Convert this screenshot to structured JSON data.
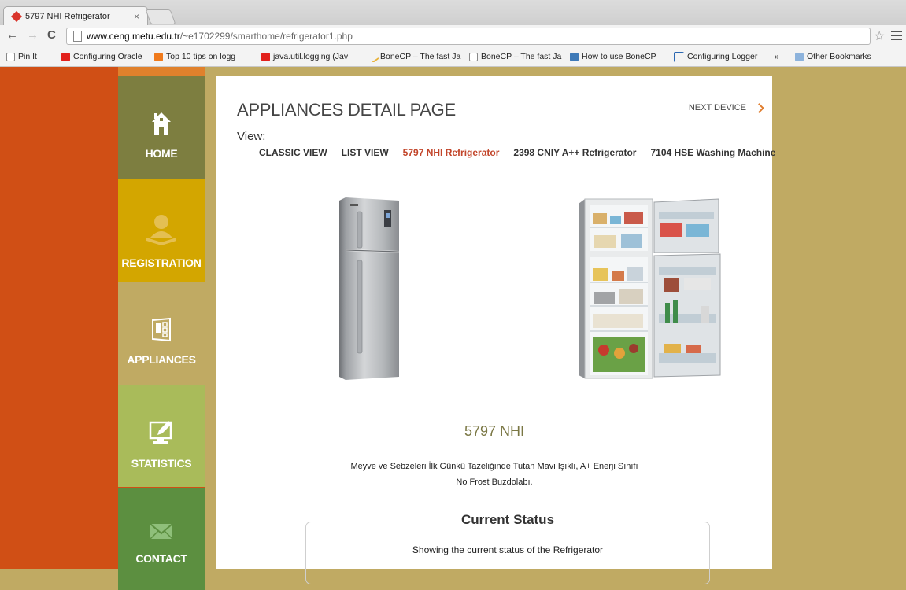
{
  "browser": {
    "tab_title": "5797 NHI Refrigerator",
    "tab_close": "×",
    "url_host": "www.ceng.metu.edu.tr",
    "url_path": "/~e1702299/smarthome/refrigerator1.php",
    "bookmarks": [
      {
        "label": "Pin It",
        "icon": "page-icon"
      },
      {
        "label": "Configuring Oracle",
        "icon": "oracle-icon"
      },
      {
        "label": "Top 10 tips on logg",
        "icon": "blogger-icon"
      },
      {
        "label": "java.util.logging (Jav",
        "icon": "oracle-icon"
      },
      {
        "label": "BoneCP – The fast Ja",
        "icon": "bone-icon"
      },
      {
        "label": "BoneCP – The fast Ja",
        "icon": "page-icon"
      },
      {
        "label": "How to use BoneCP",
        "icon": "wordpress-icon"
      },
      {
        "label": "Configuring Logger",
        "icon": "hm-icon"
      }
    ],
    "more_bookmarks": "»",
    "other_bookmarks": "Other Bookmarks"
  },
  "sidebar": {
    "items": [
      {
        "label": "HOME",
        "icon": "home-icon"
      },
      {
        "label": "REGISTRATION",
        "icon": "user-icon"
      },
      {
        "label": "APPLIANCES",
        "icon": "fridge-icon"
      },
      {
        "label": "STATISTICS",
        "icon": "monitor-pen-icon"
      },
      {
        "label": "CONTACT",
        "icon": "envelope-icon"
      }
    ]
  },
  "main": {
    "title": "APPLIANCES DETAIL PAGE",
    "next_device": "NEXT DEVICE",
    "view_label": "View:",
    "view_links": [
      "CLASSIC VIEW",
      "LIST VIEW",
      "5797 NHI Refrigerator",
      "2398 CNIY A++ Refrigerator",
      "7104 HSE Washing Machine"
    ],
    "active_view": "5797 NHI Refrigerator",
    "product_name": "5797 NHI",
    "description_line1": "Meyve ve Sebzeleri İlk Günkü Tazeliğinde Tutan Mavi Işıklı, A+ Enerji Sınıfı",
    "description_line2": "No Frost Buzdolabı.",
    "status_title": "Current Status",
    "status_text": "Showing the current status of the Refrigerator"
  }
}
